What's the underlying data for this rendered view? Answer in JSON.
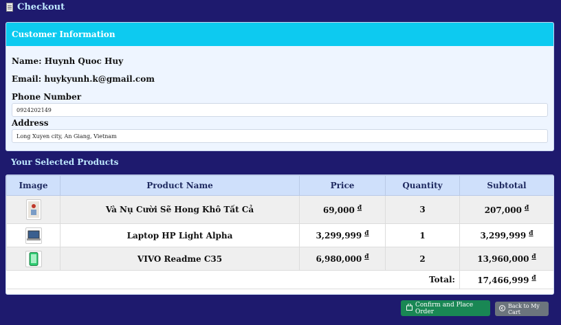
{
  "header": {
    "title": "Checkout",
    "icon": "receipt-icon"
  },
  "customer": {
    "section_title": "Customer Information",
    "name_label": "Name:",
    "name": "Huynh Quoc Huy",
    "email_label": "Email:",
    "email": "huykyunh.k@gmail.com",
    "phone_label": "Phone Number",
    "phone": "0924202149",
    "address_label": "Address",
    "address": "Long Xuyen city, An Giang, Vietnam"
  },
  "products": {
    "section_title": "Your Selected Products",
    "columns": [
      "Image",
      "Product Name",
      "Price",
      "Quantity",
      "Subtotal"
    ],
    "currency": "đ",
    "rows": [
      {
        "name": "Và Nụ Cười Sẽ Hong Khô Tất Cả",
        "price": "69,000",
        "quantity": "3",
        "subtotal": "207,000",
        "thumb": "book-cover-icon"
      },
      {
        "name": "Laptop HP Light Alpha",
        "price": "3,299,999",
        "quantity": "1",
        "subtotal": "3,299,999",
        "thumb": "laptop-icon"
      },
      {
        "name": "VIVO Readme C35",
        "price": "6,980,000",
        "quantity": "2",
        "subtotal": "13,960,000",
        "thumb": "phone-icon"
      }
    ],
    "total_label": "Total:",
    "total": "17,466,999"
  },
  "actions": {
    "confirm_label": "Confirm and Place Order",
    "back_label": "Back to My Cart"
  },
  "colors": {
    "background": "#1e1a6e",
    "card_head": "#0dcaf0",
    "confirm": "#198754",
    "back": "#6c757d"
  }
}
